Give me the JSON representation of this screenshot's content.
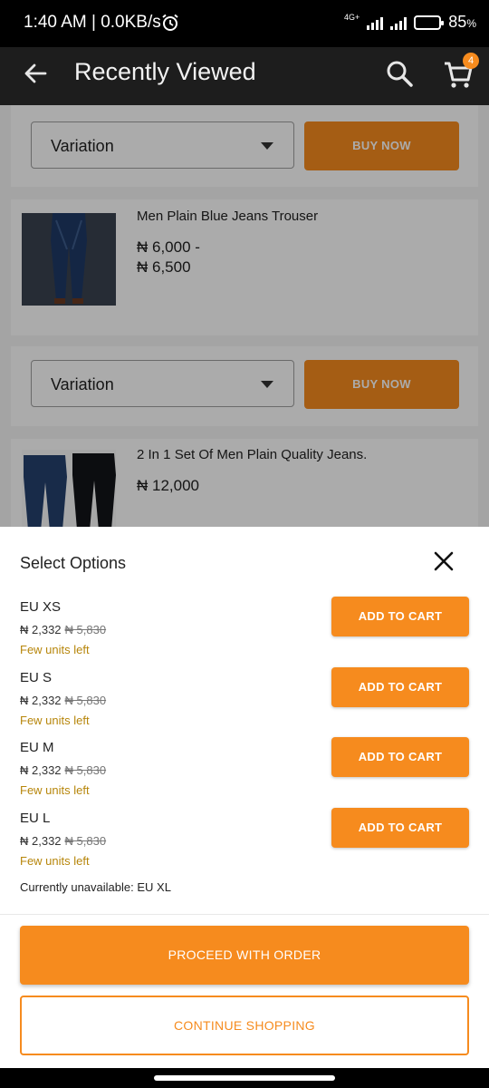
{
  "status_bar": {
    "time_speed": "1:40 AM | 0.0KB/s",
    "network_type": "4G+",
    "battery_percent": "85",
    "battery_unit": "%",
    "battery_level": 0.85,
    "icons": [
      "alarm-icon",
      "signal-icon",
      "battery-icon"
    ]
  },
  "app_bar": {
    "title": "Recently Viewed",
    "cart_count": "4",
    "icons": [
      "back-arrow-icon",
      "search-icon",
      "cart-icon"
    ]
  },
  "products": [
    {
      "variation_label": "Variation",
      "buy_label": "BUY NOW"
    },
    {
      "name": "Men Plain Blue Jeans Trouser",
      "price_line1": "₦ 6,000 -",
      "price_line2": "₦ 6,500",
      "variation_label": "Variation",
      "buy_label": "BUY NOW"
    },
    {
      "name": "2 In 1 Set Of Men Plain Quality Jeans.",
      "price_line1": "₦ 12,000"
    }
  ],
  "sheet": {
    "title": "Select Options",
    "options": [
      {
        "size": "EU XS",
        "price": "₦ 2,332",
        "old_price": "₦ 5,830",
        "stock": "Few units left",
        "button": "ADD TO CART"
      },
      {
        "size": "EU S",
        "price": "₦ 2,332",
        "old_price": "₦ 5,830",
        "stock": "Few units left",
        "button": "ADD TO CART"
      },
      {
        "size": "EU M",
        "price": "₦ 2,332",
        "old_price": "₦ 5,830",
        "stock": "Few units left",
        "button": "ADD TO CART"
      },
      {
        "size": "EU L",
        "price": "₦ 2,332",
        "old_price": "₦ 5,830",
        "stock": "Few units left",
        "button": "ADD TO CART"
      }
    ],
    "unavailable": "Currently unavailable: EU XL",
    "proceed_label": "PROCEED WITH ORDER",
    "continue_label": "CONTINUE SHOPPING"
  },
  "colors": {
    "accent": "#f68b1e",
    "stock_text": "#b7860b",
    "app_bar": "#1d1d1d"
  }
}
